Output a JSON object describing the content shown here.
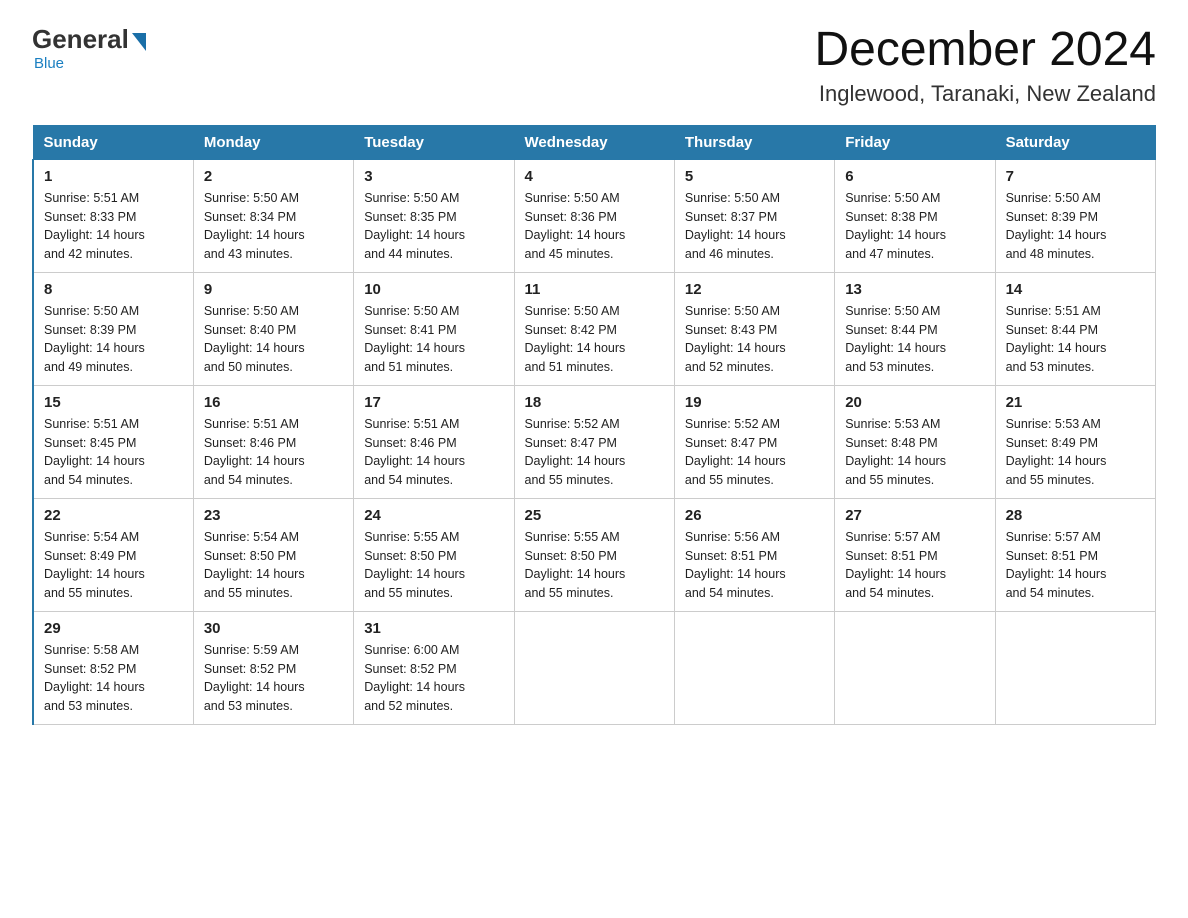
{
  "header": {
    "logo": {
      "general": "General",
      "blue": "Blue",
      "tagline": "Blue"
    },
    "title": "December 2024",
    "location": "Inglewood, Taranaki, New Zealand"
  },
  "columns": [
    "Sunday",
    "Monday",
    "Tuesday",
    "Wednesday",
    "Thursday",
    "Friday",
    "Saturday"
  ],
  "weeks": [
    [
      {
        "day": "1",
        "sunrise": "5:51 AM",
        "sunset": "8:33 PM",
        "daylight": "14 hours and 42 minutes."
      },
      {
        "day": "2",
        "sunrise": "5:50 AM",
        "sunset": "8:34 PM",
        "daylight": "14 hours and 43 minutes."
      },
      {
        "day": "3",
        "sunrise": "5:50 AM",
        "sunset": "8:35 PM",
        "daylight": "14 hours and 44 minutes."
      },
      {
        "day": "4",
        "sunrise": "5:50 AM",
        "sunset": "8:36 PM",
        "daylight": "14 hours and 45 minutes."
      },
      {
        "day": "5",
        "sunrise": "5:50 AM",
        "sunset": "8:37 PM",
        "daylight": "14 hours and 46 minutes."
      },
      {
        "day": "6",
        "sunrise": "5:50 AM",
        "sunset": "8:38 PM",
        "daylight": "14 hours and 47 minutes."
      },
      {
        "day": "7",
        "sunrise": "5:50 AM",
        "sunset": "8:39 PM",
        "daylight": "14 hours and 48 minutes."
      }
    ],
    [
      {
        "day": "8",
        "sunrise": "5:50 AM",
        "sunset": "8:39 PM",
        "daylight": "14 hours and 49 minutes."
      },
      {
        "day": "9",
        "sunrise": "5:50 AM",
        "sunset": "8:40 PM",
        "daylight": "14 hours and 50 minutes."
      },
      {
        "day": "10",
        "sunrise": "5:50 AM",
        "sunset": "8:41 PM",
        "daylight": "14 hours and 51 minutes."
      },
      {
        "day": "11",
        "sunrise": "5:50 AM",
        "sunset": "8:42 PM",
        "daylight": "14 hours and 51 minutes."
      },
      {
        "day": "12",
        "sunrise": "5:50 AM",
        "sunset": "8:43 PM",
        "daylight": "14 hours and 52 minutes."
      },
      {
        "day": "13",
        "sunrise": "5:50 AM",
        "sunset": "8:44 PM",
        "daylight": "14 hours and 53 minutes."
      },
      {
        "day": "14",
        "sunrise": "5:51 AM",
        "sunset": "8:44 PM",
        "daylight": "14 hours and 53 minutes."
      }
    ],
    [
      {
        "day": "15",
        "sunrise": "5:51 AM",
        "sunset": "8:45 PM",
        "daylight": "14 hours and 54 minutes."
      },
      {
        "day": "16",
        "sunrise": "5:51 AM",
        "sunset": "8:46 PM",
        "daylight": "14 hours and 54 minutes."
      },
      {
        "day": "17",
        "sunrise": "5:51 AM",
        "sunset": "8:46 PM",
        "daylight": "14 hours and 54 minutes."
      },
      {
        "day": "18",
        "sunrise": "5:52 AM",
        "sunset": "8:47 PM",
        "daylight": "14 hours and 55 minutes."
      },
      {
        "day": "19",
        "sunrise": "5:52 AM",
        "sunset": "8:47 PM",
        "daylight": "14 hours and 55 minutes."
      },
      {
        "day": "20",
        "sunrise": "5:53 AM",
        "sunset": "8:48 PM",
        "daylight": "14 hours and 55 minutes."
      },
      {
        "day": "21",
        "sunrise": "5:53 AM",
        "sunset": "8:49 PM",
        "daylight": "14 hours and 55 minutes."
      }
    ],
    [
      {
        "day": "22",
        "sunrise": "5:54 AM",
        "sunset": "8:49 PM",
        "daylight": "14 hours and 55 minutes."
      },
      {
        "day": "23",
        "sunrise": "5:54 AM",
        "sunset": "8:50 PM",
        "daylight": "14 hours and 55 minutes."
      },
      {
        "day": "24",
        "sunrise": "5:55 AM",
        "sunset": "8:50 PM",
        "daylight": "14 hours and 55 minutes."
      },
      {
        "day": "25",
        "sunrise": "5:55 AM",
        "sunset": "8:50 PM",
        "daylight": "14 hours and 55 minutes."
      },
      {
        "day": "26",
        "sunrise": "5:56 AM",
        "sunset": "8:51 PM",
        "daylight": "14 hours and 54 minutes."
      },
      {
        "day": "27",
        "sunrise": "5:57 AM",
        "sunset": "8:51 PM",
        "daylight": "14 hours and 54 minutes."
      },
      {
        "day": "28",
        "sunrise": "5:57 AM",
        "sunset": "8:51 PM",
        "daylight": "14 hours and 54 minutes."
      }
    ],
    [
      {
        "day": "29",
        "sunrise": "5:58 AM",
        "sunset": "8:52 PM",
        "daylight": "14 hours and 53 minutes."
      },
      {
        "day": "30",
        "sunrise": "5:59 AM",
        "sunset": "8:52 PM",
        "daylight": "14 hours and 53 minutes."
      },
      {
        "day": "31",
        "sunrise": "6:00 AM",
        "sunset": "8:52 PM",
        "daylight": "14 hours and 52 minutes."
      },
      null,
      null,
      null,
      null
    ]
  ],
  "labels": {
    "sunrise": "Sunrise:",
    "sunset": "Sunset:",
    "daylight": "Daylight:"
  }
}
